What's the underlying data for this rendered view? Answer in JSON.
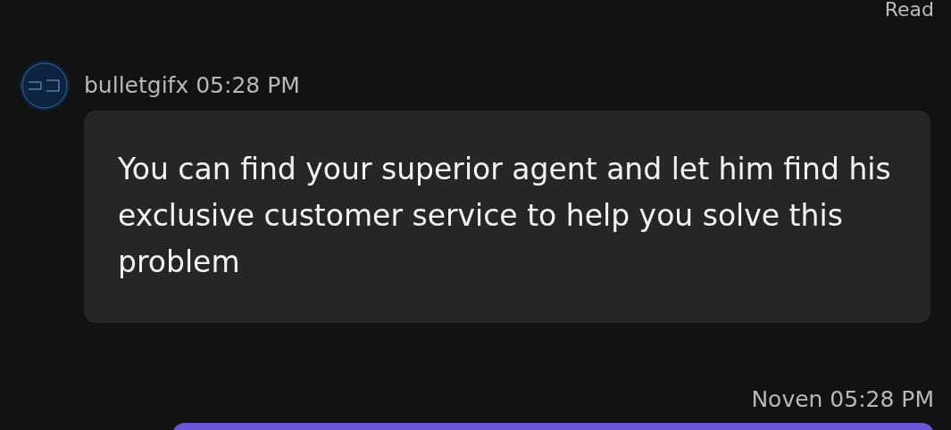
{
  "read_status": "Read",
  "messages": [
    {
      "kind": "incoming",
      "sender": "bulletgifx",
      "time": "05:28 PM",
      "text": "You can find your superior agent and let him find his exclusive customer service to help you solve this problem"
    },
    {
      "kind": "outgoing",
      "sender": "Noven",
      "time": "05:28 PM"
    }
  ]
}
